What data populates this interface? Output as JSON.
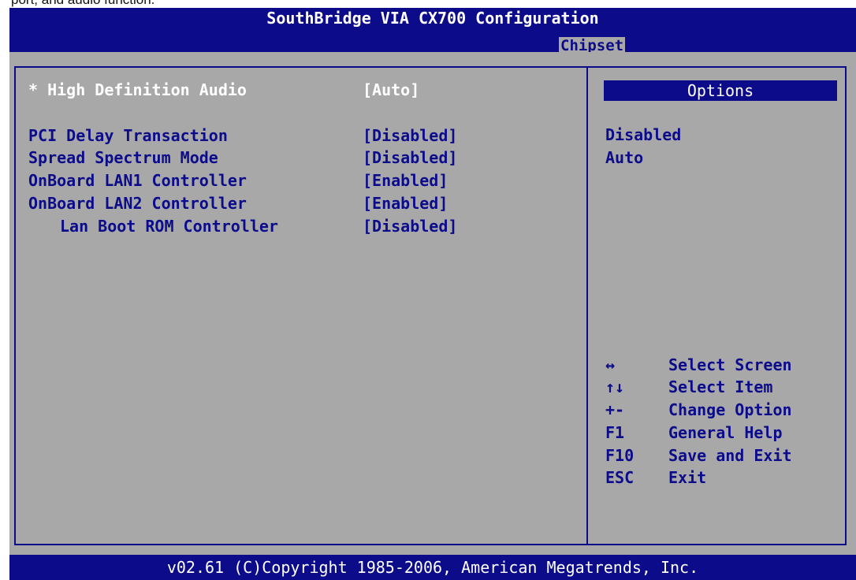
{
  "caption": "port, and audio function.",
  "title": "SouthBridge VIA CX700 Configuration",
  "tabs": [
    {
      "label": "Chipset",
      "active": true
    }
  ],
  "settings": [
    {
      "label": "* High Definition Audio",
      "value": "[Auto]",
      "selected": true
    },
    {
      "label": "PCI Delay Transaction",
      "value": "[Disabled]"
    },
    {
      "label": "Spread Spectrum Mode",
      "value": "[Disabled]"
    },
    {
      "label": "OnBoard LAN1 Controller",
      "value": "[Enabled]"
    },
    {
      "label": "OnBoard LAN2 Controller",
      "value": "[Enabled]"
    },
    {
      "label": "Lan Boot ROM Controller",
      "value": "[Disabled]",
      "indented": true
    }
  ],
  "options": {
    "header": "Options",
    "items": [
      "Disabled",
      "Auto"
    ]
  },
  "help": [
    {
      "key": "↔",
      "desc": "Select Screen"
    },
    {
      "key": "↑↓",
      "desc": "Select Item"
    },
    {
      "key": "+-",
      "desc": "Change Option"
    },
    {
      "key": "F1",
      "desc": "General Help"
    },
    {
      "key": "F10",
      "desc": "Save and Exit"
    },
    {
      "key": "ESC",
      "desc": "Exit"
    }
  ],
  "footer": "v02.61 (C)Copyright 1985-2006, American Megatrends, Inc.",
  "colors": {
    "bios_blue": "#0c0c8a",
    "panel_gray": "#a8a8a8",
    "highlight_text": "#ffffff"
  }
}
